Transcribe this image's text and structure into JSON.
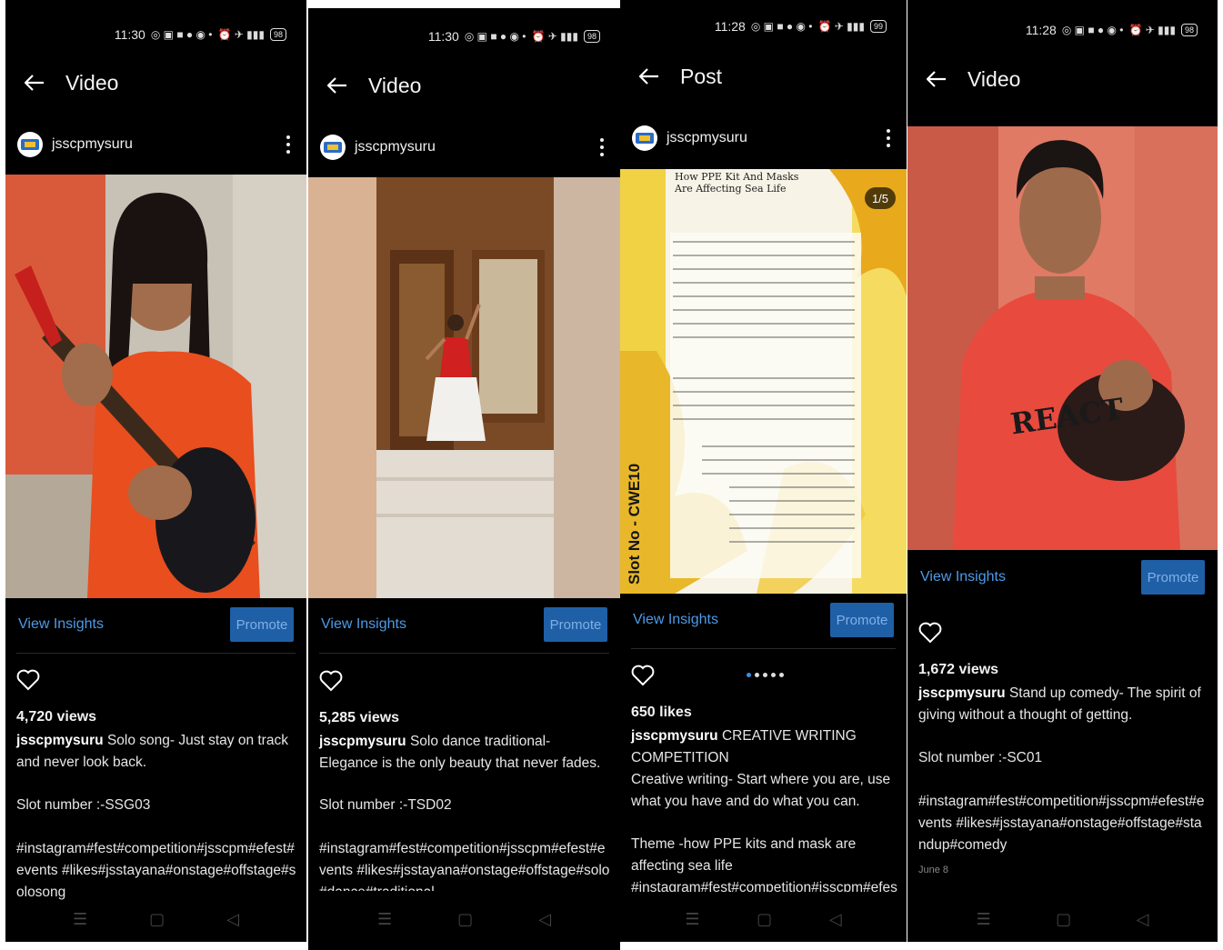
{
  "statusbar": {
    "time1": "11:30",
    "time2": "11:28",
    "battery1": "98",
    "battery2": "99"
  },
  "phones": [
    {
      "title": "Video",
      "username": "jsscpmysuru",
      "view_insights": "View Insights",
      "promote": "Promote",
      "stat": "4,720 views",
      "caption": "Solo song- Just stay on track and never look back.",
      "slot": "Slot number :-SSG03",
      "tags": "#instagram#fest#competition#jsscpm#efest#events #likes#jsstayana#onstage#offstage#solosong"
    },
    {
      "title": "Video",
      "username": "jsscpmysuru",
      "view_insights": "View Insights",
      "promote": "Promote",
      "stat": "5,285 views",
      "caption": "Solo dance traditional- Elegance is the only beauty that never fades.",
      "slot": "Slot number :-TSD02",
      "tags": "#instagram#fest#competition#jsscpm#efest#events #likes#jsstayana#onstage#offstage#solo#dance#traditional"
    },
    {
      "title": "Post",
      "username": "jsscpmysuru",
      "view_insights": "View Insights",
      "promote": "Promote",
      "counter": "1/5",
      "image_heading": "How PPE Kit And Masks Are Affecting Sea Life",
      "image_slot": "Slot No - CWE10",
      "stat": "650 likes",
      "caption": "CREATIVE WRITING COMPETITION",
      "body1": "Creative writing- Start where you are, use what you have and do what you can.",
      "body2": "Theme -how PPE kits and mask are affecting sea life",
      "tags": "#instagram#fest#competition#jsscpm#efest#events"
    },
    {
      "title": "Video",
      "username": "jsscpmysuru",
      "view_insights": "View Insights",
      "promote": "Promote",
      "shirt": "REACT",
      "stat": "1,672 views",
      "caption": "Stand up comedy- The spirit of giving without a thought of getting.",
      "slot": "Slot number :-SC01",
      "tags": "#instagram#fest#competition#jsscpm#efest#events #likes#jsstayana#onstage#offstage#standup#comedy",
      "date": "June 8"
    }
  ],
  "colors": {
    "background": "#000000",
    "link": "#4d9be8",
    "promote": "#1f5fa6"
  }
}
